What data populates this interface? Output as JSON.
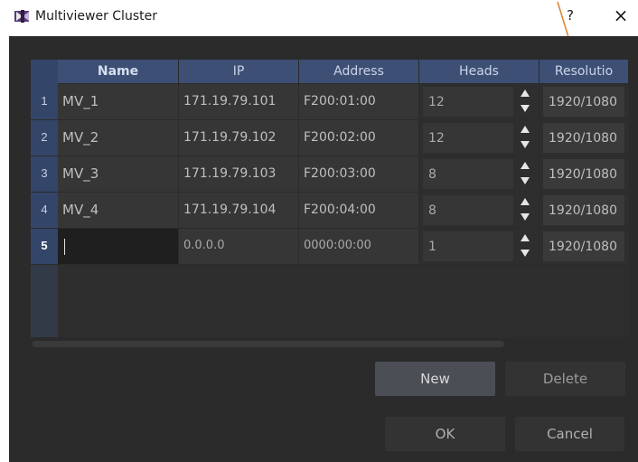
{
  "window": {
    "title": "Multiviewer Cluster",
    "help_label": "?",
    "close_label": "×"
  },
  "table": {
    "columns": [
      "Name",
      "IP",
      "Address",
      "Heads",
      "Resolutio"
    ],
    "rows": [
      {
        "num": "1",
        "name": "MV_1",
        "ip": "171.19.79.101",
        "address": "F200:01:00",
        "heads": "12",
        "resolution": "1920/1080"
      },
      {
        "num": "2",
        "name": "MV_2",
        "ip": "171.19.79.102",
        "address": "F200:02:00",
        "heads": "12",
        "resolution": "1920/1080"
      },
      {
        "num": "3",
        "name": "MV_3",
        "ip": "171.19.79.103",
        "address": "F200:03:00",
        "heads": "8",
        "resolution": "1920/1080"
      },
      {
        "num": "4",
        "name": "MV_4",
        "ip": "171.19.79.104",
        "address": "F200:04:00",
        "heads": "8",
        "resolution": "1920/1080"
      },
      {
        "num": "5",
        "name": "",
        "ip": "0.0.0.0",
        "address": "0000:00:00",
        "heads": "1",
        "resolution": "1920/1080"
      }
    ]
  },
  "buttons": {
    "new": "New",
    "delete": "Delete",
    "ok": "OK",
    "cancel": "Cancel"
  },
  "colors": {
    "dialog_bg": "#2b2b2b",
    "header_bg": "#3d4f74",
    "row_header_bg": "#34456a",
    "annotation_line": "#d9822b"
  }
}
